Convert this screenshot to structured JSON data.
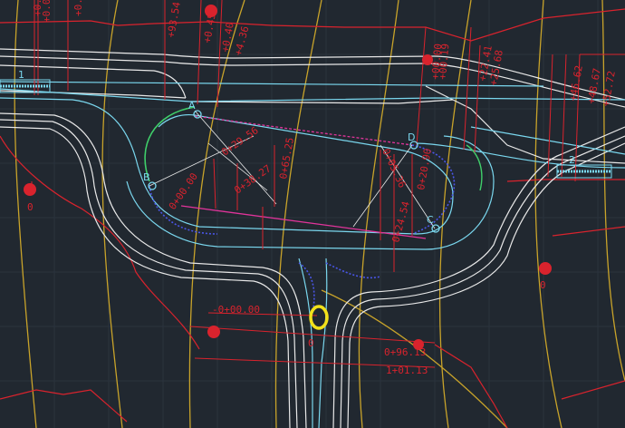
{
  "colors": {
    "background": "#212830",
    "grid": "#2b333d",
    "red": "#d9232d",
    "white": "#e8e8e8",
    "cyan": "#7ad7ee",
    "yellow": "#c8a32a",
    "magenta": "#e0349a",
    "blue_dashed": "#4a56e8",
    "green": "#3fcf6a",
    "highlight_yellow": "#f2e11a"
  },
  "labels": {
    "top_1": "+0.8",
    "top_2": "+0.0",
    "top_3": "+0.0",
    "top_4": "+93.54",
    "top_5": "+0.45",
    "top_6": "+0.40",
    "top_7": "+4.36",
    "top_8": "+00.00",
    "top_9": "+00.19",
    "top_10": "+22.41",
    "top_11": "+25.68",
    "right_1": "+46.62",
    "right_2": "+48.67",
    "right_3": "+52.72",
    "mid_1": "0+29.56",
    "mid_2": "0+38.27",
    "mid_3": "0+65.25",
    "mid_4": "0+00.00",
    "mid_5": "0+05.36",
    "mid_6": "0+20.90",
    "mid_7": "0+24.54",
    "bottom_1": "-0+00.00",
    "bottom_2": "0+96.13",
    "bottom_3": "1+01.13",
    "point_a": "A",
    "point_b": "B",
    "point_c": "C",
    "point_d": "D",
    "marker_1": "1",
    "marker_2": "2",
    "zero_left": "0",
    "zero_right": "0",
    "zero_bottom": "0"
  }
}
